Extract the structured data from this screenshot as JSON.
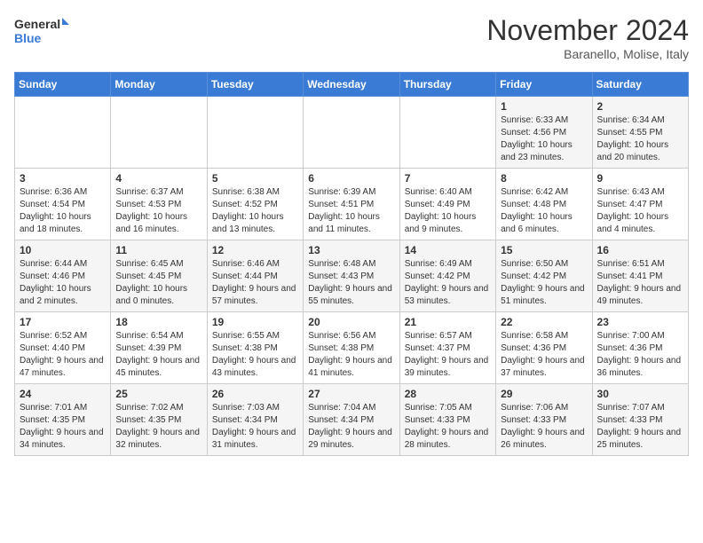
{
  "header": {
    "logo_general": "General",
    "logo_blue": "Blue",
    "month_title": "November 2024",
    "subtitle": "Baranello, Molise, Italy"
  },
  "columns": [
    "Sunday",
    "Monday",
    "Tuesday",
    "Wednesday",
    "Thursday",
    "Friday",
    "Saturday"
  ],
  "rows": [
    [
      {
        "day": "",
        "info": ""
      },
      {
        "day": "",
        "info": ""
      },
      {
        "day": "",
        "info": ""
      },
      {
        "day": "",
        "info": ""
      },
      {
        "day": "",
        "info": ""
      },
      {
        "day": "1",
        "info": "Sunrise: 6:33 AM\nSunset: 4:56 PM\nDaylight: 10 hours and 23 minutes."
      },
      {
        "day": "2",
        "info": "Sunrise: 6:34 AM\nSunset: 4:55 PM\nDaylight: 10 hours and 20 minutes."
      }
    ],
    [
      {
        "day": "3",
        "info": "Sunrise: 6:36 AM\nSunset: 4:54 PM\nDaylight: 10 hours and 18 minutes."
      },
      {
        "day": "4",
        "info": "Sunrise: 6:37 AM\nSunset: 4:53 PM\nDaylight: 10 hours and 16 minutes."
      },
      {
        "day": "5",
        "info": "Sunrise: 6:38 AM\nSunset: 4:52 PM\nDaylight: 10 hours and 13 minutes."
      },
      {
        "day": "6",
        "info": "Sunrise: 6:39 AM\nSunset: 4:51 PM\nDaylight: 10 hours and 11 minutes."
      },
      {
        "day": "7",
        "info": "Sunrise: 6:40 AM\nSunset: 4:49 PM\nDaylight: 10 hours and 9 minutes."
      },
      {
        "day": "8",
        "info": "Sunrise: 6:42 AM\nSunset: 4:48 PM\nDaylight: 10 hours and 6 minutes."
      },
      {
        "day": "9",
        "info": "Sunrise: 6:43 AM\nSunset: 4:47 PM\nDaylight: 10 hours and 4 minutes."
      }
    ],
    [
      {
        "day": "10",
        "info": "Sunrise: 6:44 AM\nSunset: 4:46 PM\nDaylight: 10 hours and 2 minutes."
      },
      {
        "day": "11",
        "info": "Sunrise: 6:45 AM\nSunset: 4:45 PM\nDaylight: 10 hours and 0 minutes."
      },
      {
        "day": "12",
        "info": "Sunrise: 6:46 AM\nSunset: 4:44 PM\nDaylight: 9 hours and 57 minutes."
      },
      {
        "day": "13",
        "info": "Sunrise: 6:48 AM\nSunset: 4:43 PM\nDaylight: 9 hours and 55 minutes."
      },
      {
        "day": "14",
        "info": "Sunrise: 6:49 AM\nSunset: 4:42 PM\nDaylight: 9 hours and 53 minutes."
      },
      {
        "day": "15",
        "info": "Sunrise: 6:50 AM\nSunset: 4:42 PM\nDaylight: 9 hours and 51 minutes."
      },
      {
        "day": "16",
        "info": "Sunrise: 6:51 AM\nSunset: 4:41 PM\nDaylight: 9 hours and 49 minutes."
      }
    ],
    [
      {
        "day": "17",
        "info": "Sunrise: 6:52 AM\nSunset: 4:40 PM\nDaylight: 9 hours and 47 minutes."
      },
      {
        "day": "18",
        "info": "Sunrise: 6:54 AM\nSunset: 4:39 PM\nDaylight: 9 hours and 45 minutes."
      },
      {
        "day": "19",
        "info": "Sunrise: 6:55 AM\nSunset: 4:38 PM\nDaylight: 9 hours and 43 minutes."
      },
      {
        "day": "20",
        "info": "Sunrise: 6:56 AM\nSunset: 4:38 PM\nDaylight: 9 hours and 41 minutes."
      },
      {
        "day": "21",
        "info": "Sunrise: 6:57 AM\nSunset: 4:37 PM\nDaylight: 9 hours and 39 minutes."
      },
      {
        "day": "22",
        "info": "Sunrise: 6:58 AM\nSunset: 4:36 PM\nDaylight: 9 hours and 37 minutes."
      },
      {
        "day": "23",
        "info": "Sunrise: 7:00 AM\nSunset: 4:36 PM\nDaylight: 9 hours and 36 minutes."
      }
    ],
    [
      {
        "day": "24",
        "info": "Sunrise: 7:01 AM\nSunset: 4:35 PM\nDaylight: 9 hours and 34 minutes."
      },
      {
        "day": "25",
        "info": "Sunrise: 7:02 AM\nSunset: 4:35 PM\nDaylight: 9 hours and 32 minutes."
      },
      {
        "day": "26",
        "info": "Sunrise: 7:03 AM\nSunset: 4:34 PM\nDaylight: 9 hours and 31 minutes."
      },
      {
        "day": "27",
        "info": "Sunrise: 7:04 AM\nSunset: 4:34 PM\nDaylight: 9 hours and 29 minutes."
      },
      {
        "day": "28",
        "info": "Sunrise: 7:05 AM\nSunset: 4:33 PM\nDaylight: 9 hours and 28 minutes."
      },
      {
        "day": "29",
        "info": "Sunrise: 7:06 AM\nSunset: 4:33 PM\nDaylight: 9 hours and 26 minutes."
      },
      {
        "day": "30",
        "info": "Sunrise: 7:07 AM\nSunset: 4:33 PM\nDaylight: 9 hours and 25 minutes."
      }
    ]
  ]
}
